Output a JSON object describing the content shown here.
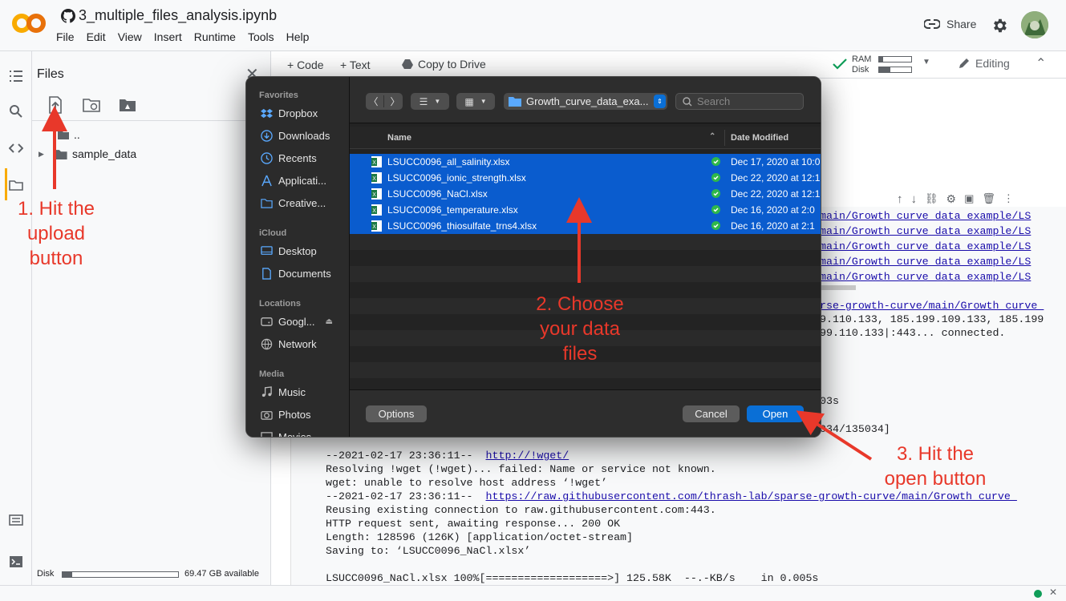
{
  "notebook": {
    "title": "3_multiple_files_analysis.ipynb",
    "menu": [
      "File",
      "Edit",
      "View",
      "Insert",
      "Runtime",
      "Tools",
      "Help"
    ],
    "share_label": "Share"
  },
  "files_panel": {
    "title": "Files",
    "tree": {
      "parent": "..",
      "folder": "sample_data"
    },
    "disk_label": "Disk",
    "disk_available": "69.47 GB available"
  },
  "toolbar": {
    "code_label": "+ Code",
    "text_label": "+ Text",
    "copy_drive_label": "Copy to Drive",
    "ram_label": "RAM",
    "disk_label": "Disk",
    "editing_label": "Editing"
  },
  "output": {
    "top_lines": [
      "main/Growth_curve_data_example/LS",
      "main/Growth_curve_data_example/LS",
      "main/Growth_curve_data_example/LS",
      "main/Growth_curve_data_example/LS",
      "main/Growth_curve_data_example/LS"
    ],
    "resolve_link": "rse-growth-curve/main/Growth_curve_",
    "resolve_line1": "9.110.133, 185.199.109.133, 185.199",
    "resolve_line2": "99.110.133|:443... connected.",
    "time_line": "03s",
    "size_line": "034/135034]",
    "log_date1": "--2021-02-17 23:36:11--  ",
    "log_link1": "http://!wget/",
    "log_resolve": "Resolving !wget (!wget)... failed: Name or service not known.",
    "log_unable": "wget: unable to resolve host address ‘!wget’",
    "log_date2": "--2021-02-17 23:36:11--  ",
    "log_link2": "https://raw.githubusercontent.com/thrash-lab/sparse-growth-curve/main/Growth_curve_",
    "log_reuse": "Reusing existing connection to raw.githubusercontent.com:443.",
    "log_http": "HTTP request sent, awaiting response... 200 OK",
    "log_length": "Length: 128596 (126K) [application/octet-stream]",
    "log_saving": "Saving to: ‘LSUCC0096_NaCl.xlsx’",
    "log_progress": "LSUCC0096_NaCl.xlsx 100%[===================>] 125.58K  --.-KB/s    in 0.005s"
  },
  "dialog": {
    "sidebar": {
      "favorites_header": "Favorites",
      "favorites": [
        {
          "label": "Dropbox",
          "icon": "dropbox-icon"
        },
        {
          "label": "Downloads",
          "icon": "download-icon"
        },
        {
          "label": "Recents",
          "icon": "clock-icon"
        },
        {
          "label": "Applicati...",
          "icon": "applications-icon"
        },
        {
          "label": "Creative...",
          "icon": "folder-icon"
        }
      ],
      "icloud_header": "iCloud",
      "icloud": [
        {
          "label": "Desktop",
          "icon": "desktop-icon"
        },
        {
          "label": "Documents",
          "icon": "document-icon"
        }
      ],
      "locations_header": "Locations",
      "locations": [
        {
          "label": "Googl...",
          "icon": "drive-icon"
        },
        {
          "label": "Network",
          "icon": "network-icon"
        }
      ],
      "media_header": "Media",
      "media": [
        {
          "label": "Music",
          "icon": "music-icon"
        },
        {
          "label": "Photos",
          "icon": "camera-icon"
        },
        {
          "label": "Movies",
          "icon": "film-icon"
        }
      ]
    },
    "path": "Growth_curve_data_exa...",
    "search_placeholder": "Search",
    "col_name": "Name",
    "col_date": "Date Modified",
    "files": [
      {
        "name": "LSUCC0096_all_salinity.xlsx",
        "date": "Dec 17, 2020 at 10:0"
      },
      {
        "name": "LSUCC0096_ionic_strength.xlsx",
        "date": "Dec 22, 2020 at 12:1"
      },
      {
        "name": "LSUCC0096_NaCl.xlsx",
        "date": "Dec 22, 2020 at 12:1"
      },
      {
        "name": "LSUCC0096_temperature.xlsx",
        "date": "Dec 16, 2020 at 2:0"
      },
      {
        "name": "LSUCC0096_thiosulfate_trns4.xlsx",
        "date": "Dec 16, 2020 at 2:1"
      }
    ],
    "options_label": "Options",
    "cancel_label": "Cancel",
    "open_label": "Open"
  },
  "annotations": {
    "step1": [
      "1. Hit the",
      "upload",
      "button"
    ],
    "step2": [
      "2. Choose",
      "your data",
      "files"
    ],
    "step3": [
      "3. Hit the",
      "open button"
    ],
    "color": "#e8382a"
  },
  "colors": {
    "selection": "#0a5cce",
    "open_button": "#0a6fd6",
    "accent_link": "#1a0dab"
  }
}
